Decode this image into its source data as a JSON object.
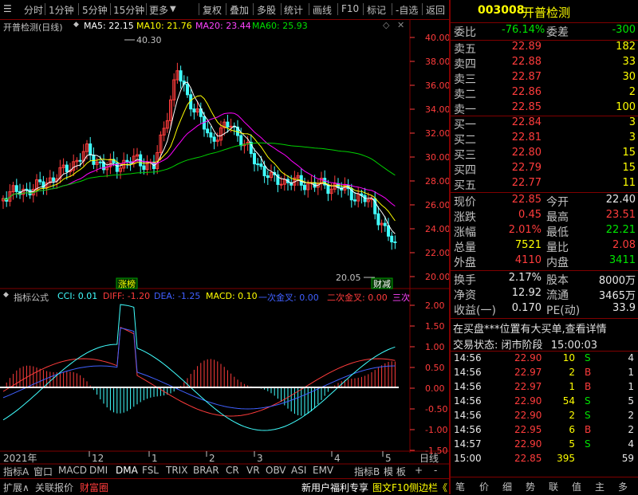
{
  "toolbar": {
    "left_items": [
      "分时",
      "1分钟",
      "5分钟",
      "15分钟",
      "更多"
    ],
    "right_items": [
      "复权",
      "叠加",
      "多股",
      "统计",
      "画线",
      "F10",
      "标记",
      "-自选",
      "返回"
    ]
  },
  "chart_header": {
    "title": "开普检测(日线)",
    "ma5": "MA5: 22.15",
    "ma10": "MA10: 21.76",
    "ma20": "MA20: 23.44",
    "ma60": "MA60: 25.93"
  },
  "price_axis": [
    "40.00",
    "38.00",
    "36.00",
    "34.00",
    "32.00",
    "30.00",
    "28.00",
    "26.00",
    "24.00",
    "22.00",
    "20.00"
  ],
  "annotations": {
    "high": "40.30",
    "low": "20.05",
    "tag1": "涨榜",
    "tag2": "财减"
  },
  "indicator_header": {
    "name": "指标公式",
    "cci": "CCI: 0.01",
    "diff": "DIFF: -1.20",
    "dea": "DEA: -1.25",
    "macd": "MACD: 0.10",
    "first_cross": "一次金叉: 0.00",
    "second_cross": "二次金叉: 0.00",
    "third_cross": "三次"
  },
  "indicator_axis": [
    "2.00",
    "1.50",
    "1.00",
    "0.50",
    "0.00",
    "-0.50",
    "-1.00",
    "-1.50"
  ],
  "time_axis": {
    "year": "2021年",
    "m12": "12",
    "m1": "1",
    "m2": "2",
    "m3": "3",
    "m4": "4",
    "m5": "5",
    "period": "日线"
  },
  "bottom_tabs": [
    "指标A",
    "窗口",
    "MACD",
    "DMI",
    "DMA",
    "FSL",
    "TRIX",
    "BRAR",
    "CR",
    "VR",
    "OBV",
    "ASI",
    "EMV",
    "指标B",
    "模 板",
    "+",
    "-"
  ],
  "status_bar": {
    "left": [
      "扩展∧",
      "关联报价",
      "财富圈"
    ],
    "promo": "新用户福利专享",
    "f10": "图文F10",
    "side": "侧边栏《"
  },
  "right_tabs": [
    "笔",
    "价",
    "细",
    "势",
    "联",
    "值",
    "主",
    "多"
  ],
  "quote": {
    "code": "003008",
    "name": "开普检测",
    "weibi_label": "委比",
    "weibi": "-76.14%",
    "weicha_label": "委差",
    "weicha": "-300",
    "sells": [
      {
        "label": "卖五",
        "price": "22.89",
        "vol": "182"
      },
      {
        "label": "卖四",
        "price": "22.88",
        "vol": "33"
      },
      {
        "label": "卖三",
        "price": "22.87",
        "vol": "30"
      },
      {
        "label": "卖二",
        "price": "22.86",
        "vol": "2"
      },
      {
        "label": "卖一",
        "price": "22.85",
        "vol": "100"
      }
    ],
    "buys": [
      {
        "label": "买一",
        "price": "22.84",
        "vol": "3"
      },
      {
        "label": "买二",
        "price": "22.81",
        "vol": "3"
      },
      {
        "label": "买三",
        "price": "22.80",
        "vol": "15"
      },
      {
        "label": "买四",
        "price": "22.79",
        "vol": "15"
      },
      {
        "label": "买五",
        "price": "22.77",
        "vol": "11"
      }
    ],
    "stats": [
      {
        "l1": "现价",
        "v1": "22.85",
        "c1": "red",
        "l2": "今开",
        "v2": "22.40",
        "c2": "white"
      },
      {
        "l1": "涨跌",
        "v1": "0.45",
        "c1": "red",
        "l2": "最高",
        "v2": "23.51",
        "c2": "red"
      },
      {
        "l1": "涨幅",
        "v1": "2.01%",
        "c1": "red",
        "l2": "最低",
        "v2": "22.21",
        "c2": "green"
      },
      {
        "l1": "总量",
        "v1": "7521",
        "c1": "yellow",
        "l2": "量比",
        "v2": "2.08",
        "c2": "red"
      },
      {
        "l1": "外盘",
        "v1": "4110",
        "c1": "red",
        "l2": "内盘",
        "v2": "3411",
        "c2": "green"
      }
    ],
    "stats2": [
      {
        "l1": "换手",
        "v1": "2.17%",
        "l2": "股本",
        "v2": "8000万"
      },
      {
        "l1": "净资",
        "v1": "12.92",
        "l2": "流通",
        "v2": "3465万"
      },
      {
        "l1": "收益(一)",
        "v1": "0.170",
        "l2": "PE(动)",
        "v2": "33.9"
      }
    ],
    "notice": "在买盘***位置有大买单,查看详情",
    "status_label": "交易状态:",
    "status_value": "闭市阶段",
    "status_time": "15:00:03",
    "ticks": [
      {
        "t": "14:56",
        "p": "22.90",
        "v": "10",
        "d": "S",
        "n": "4"
      },
      {
        "t": "14:56",
        "p": "22.97",
        "v": "2",
        "d": "B",
        "n": "1"
      },
      {
        "t": "14:56",
        "p": "22.97",
        "v": "1",
        "d": "B",
        "n": "1"
      },
      {
        "t": "14:56",
        "p": "22.90",
        "v": "54",
        "d": "S",
        "n": "5"
      },
      {
        "t": "14:56",
        "p": "22.90",
        "v": "2",
        "d": "S",
        "n": "2"
      },
      {
        "t": "14:56",
        "p": "22.95",
        "v": "6",
        "d": "B",
        "n": "2"
      },
      {
        "t": "14:57",
        "p": "22.90",
        "v": "5",
        "d": "S",
        "n": "4"
      },
      {
        "t": "15:00",
        "p": "22.85",
        "v": "395",
        "d": "",
        "n": "59"
      }
    ]
  },
  "colors": {
    "up": "#ff3c3c",
    "down": "#00ffff",
    "ma5": "#ffffff",
    "ma10": "#ffff00",
    "ma20": "#ff00ff",
    "ma60": "#00d000",
    "border": "#800000"
  }
}
